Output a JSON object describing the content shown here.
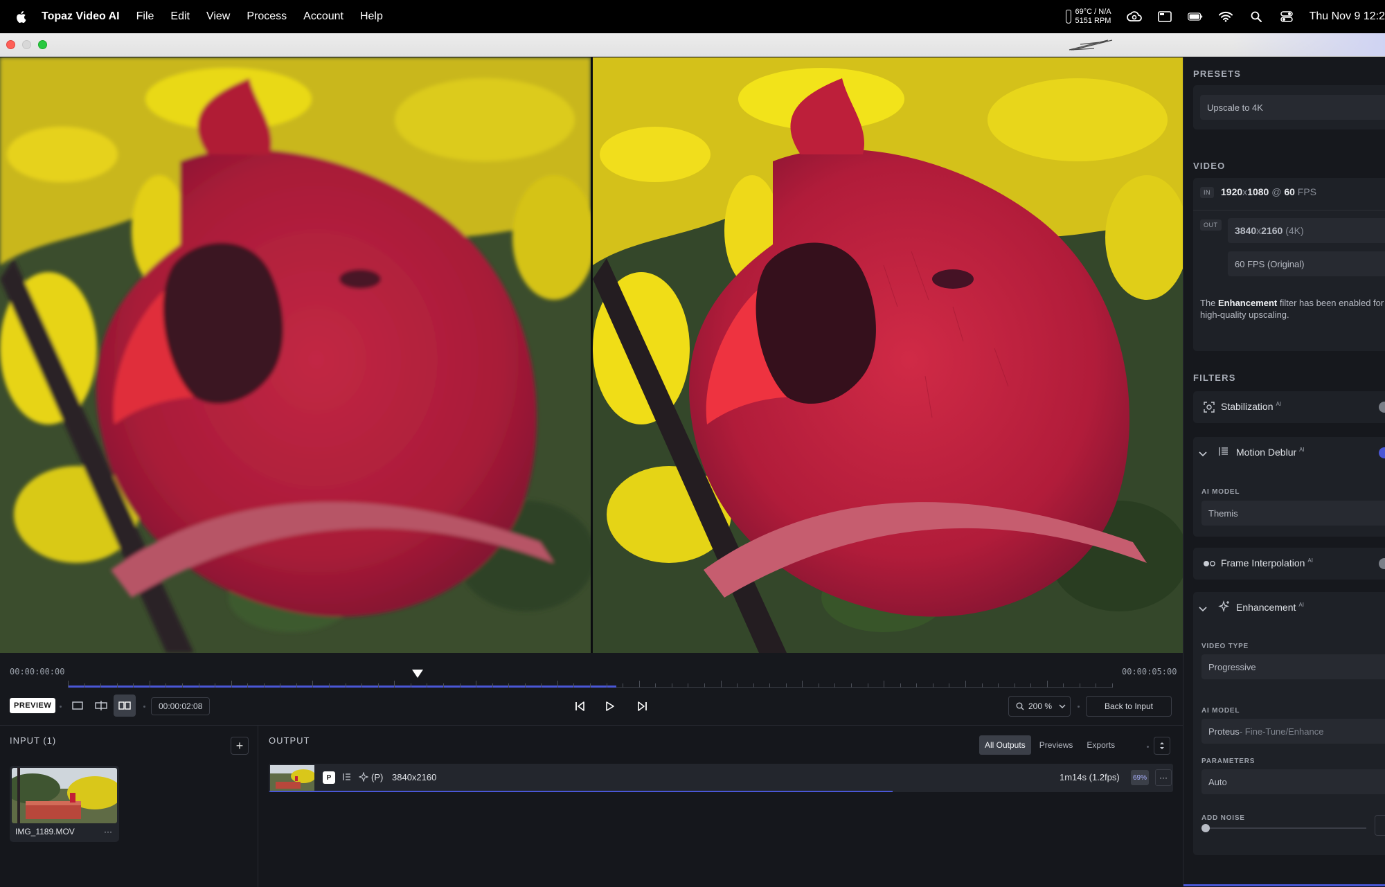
{
  "menubar": {
    "app_name": "Topaz Video AI",
    "menus": [
      "File",
      "Edit",
      "View",
      "Process",
      "Account",
      "Help"
    ],
    "temp_line1": "69°C / N/A",
    "temp_line2": "5151 RPM",
    "clock": "Thu Nov 9  12:2"
  },
  "timeline": {
    "start_tc": "00:00:00:00",
    "end_tc": "00:00:05:00",
    "current_tc": "00:00:02:08",
    "playhead_fraction": 0.335,
    "played_fraction": 0.525,
    "preview_label": "PREVIEW",
    "zoom": "200 %",
    "back_label": "Back to Input"
  },
  "input_panel": {
    "title": "INPUT (1)",
    "add_label": "+",
    "clips": [
      {
        "name": "IMG_1189.MOV",
        "more": "···"
      }
    ]
  },
  "output_panel": {
    "title": "OUTPUT",
    "tabs": [
      "All Outputs",
      "Previews",
      "Exports"
    ],
    "active_tab": "All Outputs",
    "rows": [
      {
        "badge": "P",
        "mode": "(P)",
        "resolution": "3840x2160",
        "eta": "1m14s (1.2fps)",
        "percent": "69%",
        "progress_fraction": 0.69,
        "more": "···"
      }
    ]
  },
  "sidebar": {
    "presets_label": "PRESETS",
    "preset_value": "Upscale to 4K",
    "video_label": "VIDEO",
    "in_tag": "IN",
    "in_res_w": "1920",
    "in_res_x": "x",
    "in_res_h": "1080",
    "in_at": " @ ",
    "in_fps": "60",
    "in_fps_unit": " FPS",
    "out_tag": "OUT",
    "out_res_w": "3840",
    "out_res_x": "x",
    "out_res_h": "2160",
    "out_res_note": " (4K)",
    "out_fps": "60 FPS (Original)",
    "note_pre": "The ",
    "note_bold": "Enhancement",
    "note_post": " filter has been enabled for high-quality upscaling.",
    "filters_label": "FILTERS",
    "filters": {
      "stabilization": {
        "name": "Stabilization",
        "ai": "AI",
        "enabled": false
      },
      "motion_deblur": {
        "name": "Motion Deblur",
        "ai": "AI",
        "enabled": true,
        "model_label": "AI MODEL",
        "model": "Themis"
      },
      "frame_interp": {
        "name": "Frame Interpolation",
        "ai": "AI",
        "enabled": false
      },
      "enhancement": {
        "name": "Enhancement",
        "ai": "AI",
        "video_type_label": "VIDEO TYPE",
        "video_type": "Progressive",
        "model_label": "AI MODEL",
        "model": "Proteus",
        "model_sub": " - Fine-Tune/Enhance",
        "params_label": "PARAMETERS",
        "params": "Auto",
        "noise_label": "ADD NOISE",
        "noise_level": 0
      }
    }
  },
  "colors": {
    "accent": "#4a57d6",
    "cardinal_red": "#c8203a",
    "foliage_yellow": "#e7d214",
    "background": "#14161b"
  }
}
